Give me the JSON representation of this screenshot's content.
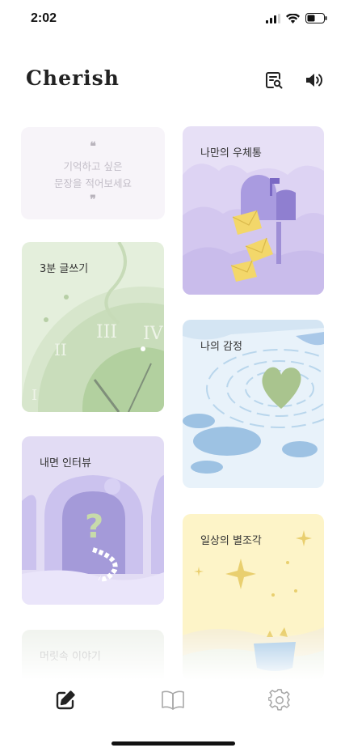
{
  "status_bar": {
    "time": "2:02"
  },
  "header": {
    "app_title": "Cherish",
    "search_icon": "search-document-icon",
    "sound_icon": "speaker-icon"
  },
  "quote_card": {
    "open_mark": "❝",
    "lines": [
      "기억하고 싶은",
      "문장을 적어보세요"
    ],
    "close_mark": "❞"
  },
  "cards": {
    "mailbox": {
      "label": "나만의 우체통"
    },
    "writing": {
      "label": "3분 글쓰기"
    },
    "emotion": {
      "label": "나의 감정"
    },
    "interview": {
      "label": "내면 인터뷰"
    },
    "stars": {
      "label": "일상의 별조각"
    },
    "story": {
      "label": "머릿속 이야기"
    }
  },
  "tab_bar": {
    "items": [
      {
        "icon": "pencil-square-icon",
        "active": true
      },
      {
        "icon": "book-icon",
        "active": false
      },
      {
        "icon": "gear-icon",
        "active": false
      }
    ]
  },
  "colors": {
    "active_tab": "#222222",
    "inactive_tab": "#a8a8a8",
    "mailbox_bg": "#e7e0f6",
    "writing_bg": "#e4efdc",
    "emotion_bg": "#e8f2fa",
    "interview_bg": "#e2dcf4",
    "stars_bg": "#fdf4c8"
  }
}
